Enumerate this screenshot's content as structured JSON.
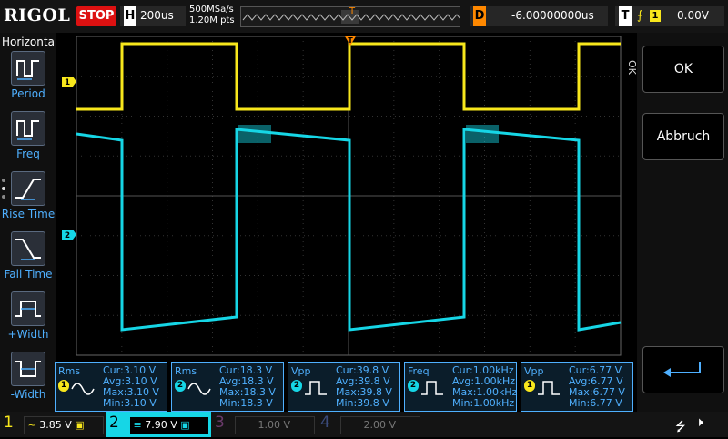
{
  "brand": "RIGOL",
  "run_state": "STOP",
  "horizontal": {
    "letter": "H",
    "timebase": "200us",
    "sample_rate": "500MSa/s",
    "points": "1.20M pts"
  },
  "delay": {
    "letter": "D",
    "value": "-6.00000000us"
  },
  "trigger": {
    "letter": "T",
    "edge": "⨍",
    "source": "1",
    "level": "0.00V"
  },
  "left_menu": {
    "title": "Horizontal",
    "items": [
      {
        "label": "Period",
        "icon": "period-icon"
      },
      {
        "label": "Freq",
        "icon": "frequency-icon"
      },
      {
        "label": "Rise Time",
        "icon": "rise-time-icon"
      },
      {
        "label": "Fall Time",
        "icon": "fall-time-icon"
      },
      {
        "label": "+Width",
        "icon": "positive-width-icon"
      },
      {
        "label": "-Width",
        "icon": "negative-width-icon"
      }
    ]
  },
  "right_menu": {
    "side_label": "OK",
    "ok_label": "OK",
    "cancel_label": "Abbruch",
    "back_icon": "return-arrow-icon"
  },
  "channel_markers": {
    "ch1": "1",
    "ch2": "2"
  },
  "measurements": [
    {
      "type": "Rms",
      "source": "1",
      "color": "#f8e71c",
      "cur": "Cur:3.10 V",
      "avg": "Avg:3.10 V",
      "max": "Max:3.10 V",
      "min": "Min:3.10 V"
    },
    {
      "type": "Rms",
      "source": "2",
      "color": "#16d6e6",
      "cur": "Cur:18.3 V",
      "avg": "Avg:18.3 V",
      "max": "Max:18.3 V",
      "min": "Min:18.3 V"
    },
    {
      "type": "Vpp",
      "source": "2",
      "color": "#16d6e6",
      "cur": "Cur:39.8 V",
      "avg": "Avg:39.8 V",
      "max": "Max:39.8 V",
      "min": "Min:39.8 V"
    },
    {
      "type": "Freq",
      "source": "2",
      "color": "#16d6e6",
      "cur": "Cur:1.00kHz",
      "avg": "Avg:1.00kHz",
      "max": "Max:1.00kHz",
      "min": "Min:1.00kHz"
    },
    {
      "type": "Vpp",
      "source": "1",
      "color": "#f8e71c",
      "cur": "Cur:6.77 V",
      "avg": "Avg:6.77 V",
      "max": "Max:6.77 V",
      "min": "Min:6.77 V"
    }
  ],
  "channels": [
    {
      "num": "1",
      "scale": "3.85 V",
      "color": "#f8e71c",
      "active": true
    },
    {
      "num": "2",
      "scale": "7.90 V",
      "color": "#16d6e6",
      "active": true
    },
    {
      "num": "3",
      "scale": "1.00 V",
      "color": "#a040a0",
      "active": false
    },
    {
      "num": "4",
      "scale": "2.00 V",
      "color": "#3060c0",
      "active": false
    }
  ],
  "status_icons": [
    "usb-icon",
    "speaker-muted-icon"
  ],
  "colors": {
    "ch1": "#f8e71c",
    "ch2": "#16d6e6",
    "trigger": "#ff8800",
    "stop": "#dd1111"
  }
}
